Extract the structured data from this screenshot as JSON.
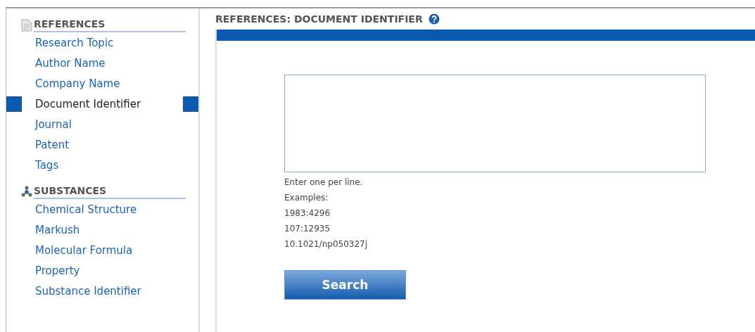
{
  "sidebar": {
    "sections": [
      {
        "kind": "references",
        "title": "REFERENCES",
        "items": [
          {
            "label": "Research Topic",
            "selected": false
          },
          {
            "label": "Author Name",
            "selected": false
          },
          {
            "label": "Company Name",
            "selected": false
          },
          {
            "label": "Document Identifier",
            "selected": true
          },
          {
            "label": "Journal",
            "selected": false
          },
          {
            "label": "Patent",
            "selected": false
          },
          {
            "label": "Tags",
            "selected": false
          }
        ]
      },
      {
        "kind": "substances",
        "title": "SUBSTANCES",
        "items": [
          {
            "label": "Chemical Structure",
            "selected": false
          },
          {
            "label": "Markush",
            "selected": false
          },
          {
            "label": "Molecular Formula",
            "selected": false
          },
          {
            "label": "Property",
            "selected": false
          },
          {
            "label": "Substance Identifier",
            "selected": false
          }
        ]
      }
    ]
  },
  "main": {
    "title": "REFERENCES: DOCUMENT IDENTIFIER",
    "hint": "Enter one per line.",
    "examples_label": "Examples:",
    "examples": [
      "1983:4296",
      "107:12935",
      "10.1021/np050327j"
    ],
    "search_button": "Search"
  }
}
